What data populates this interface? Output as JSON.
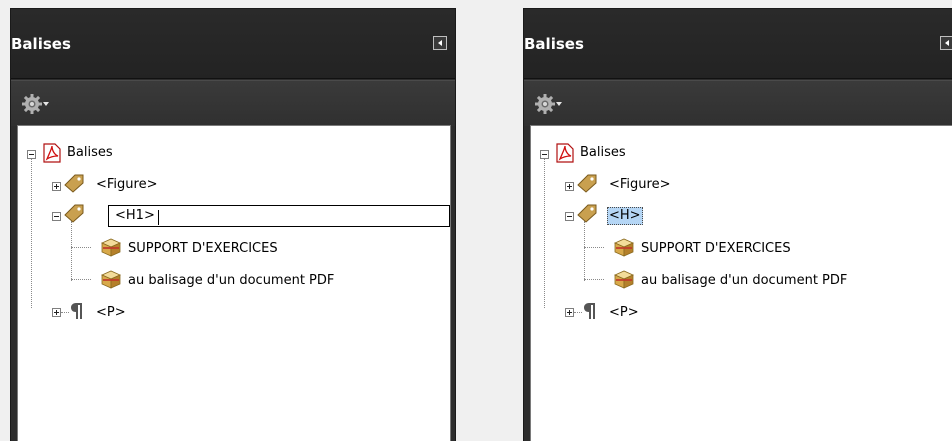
{
  "colors": {
    "panel_bg": "#2d2d2d",
    "header_text": "#ffffff",
    "tree_bg": "#ffffff",
    "selection": "#b5d6f5"
  },
  "left_panel": {
    "title": "Balises",
    "tree": {
      "root": "Balises",
      "figure": "<Figure>",
      "heading_edit_value": "<H1>",
      "content_1": "SUPPORT D'EXERCICES",
      "content_2": "au balisage d'un document PDF",
      "paragraph": "<P>"
    }
  },
  "right_panel": {
    "title": "Balises",
    "tree": {
      "root": "Balises",
      "figure": "<Figure>",
      "heading": "<H>",
      "content_1": "SUPPORT D'EXERCICES",
      "content_2": "au balisage d'un document PDF",
      "paragraph": "<P>"
    }
  },
  "icons": {
    "collapse": "left-arrow-icon",
    "options": "gear-icon",
    "root": "pdf-document-icon",
    "tag": "tag-icon",
    "content": "content-box-icon",
    "paragraph": "pilcrow-icon"
  }
}
